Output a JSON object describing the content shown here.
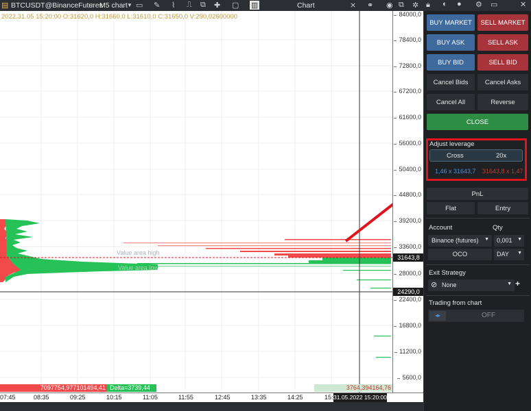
{
  "topbar": {
    "symbol": "BTCUSDT@BinanceFutures",
    "interval": "M5 chart",
    "title": "Chart"
  },
  "ohlc": "2022.31.05 15:20:00 O:31620,0 H:31660,0 L:31610,0 C:31650,0 V:290,02600000",
  "y_ticks": [
    "84000,0",
    "78400,0",
    "72800,0",
    "67200,0",
    "61600,0",
    "56000,0",
    "50400,0",
    "44800,0",
    "39200,0",
    "33600,0",
    "28000,0",
    "22400,0",
    "16800,0",
    "11200,0",
    "5600,0"
  ],
  "price_tags": {
    "last": "31643,8",
    "crosshair": "24290,0"
  },
  "x_ticks": [
    "07:45",
    "08:35",
    "09:25",
    "10:15",
    "11:05",
    "11:55",
    "12:45",
    "13:35",
    "14:25",
    "15:15"
  ],
  "crosshair_time": "31.05.2022 15:20:00",
  "value_area": {
    "high": "Value area high",
    "low": "Value area low"
  },
  "bottom": {
    "left": "7097754,97",
    "mid": "7101494,41",
    "delta": "Delta=3739,44",
    "right1": "3764,39",
    "right2": "4164,76"
  },
  "panel": {
    "buy_market": "BUY MARKET",
    "sell_market": "SELL MARKET",
    "buy_ask": "BUY ASK",
    "sell_ask": "SELL ASK",
    "buy_bid": "BUY BID",
    "sell_bid": "SELL BID",
    "cancel_bids": "Cancel Bids",
    "cancel_asks": "Cancel Asks",
    "cancel_all": "Cancel All",
    "reverse": "Reverse",
    "close": "CLOSE",
    "adjust_leverage": "Adjust leverage",
    "cross": "Cross",
    "leverage": "20x",
    "pos_buy": "1,46 x 31643,7",
    "pos_sell": "31643,8 x 1,47",
    "pnl": "PnL",
    "flat": "Flat",
    "entry": "Entry",
    "account_label": "Account",
    "qty_label": "Qty",
    "account_value": "Binance (futures)",
    "qty_value": "0,001",
    "oco": "OCO",
    "tif": "DAY",
    "exit_strategy": "Exit Strategy",
    "exit_value": "None",
    "trading_from_chart": "Trading from chart",
    "off": "OFF"
  },
  "colors": {
    "buy": "#3e6a9e",
    "sell": "#a7333b",
    "close": "#2e8d44",
    "highlight": "#e0141c",
    "profile_bid": "#26c157",
    "profile_ask": "#f24a4a"
  }
}
